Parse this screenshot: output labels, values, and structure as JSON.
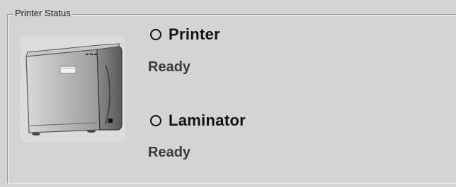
{
  "group": {
    "title": "Printer Status"
  },
  "device_icon": "card-printer-icon",
  "printer": {
    "name": "Printer",
    "status": "Ready",
    "indicator_icon": "status-circle-icon"
  },
  "laminator": {
    "name": "Laminator",
    "status": "Ready",
    "indicator_icon": "status-circle-icon"
  }
}
